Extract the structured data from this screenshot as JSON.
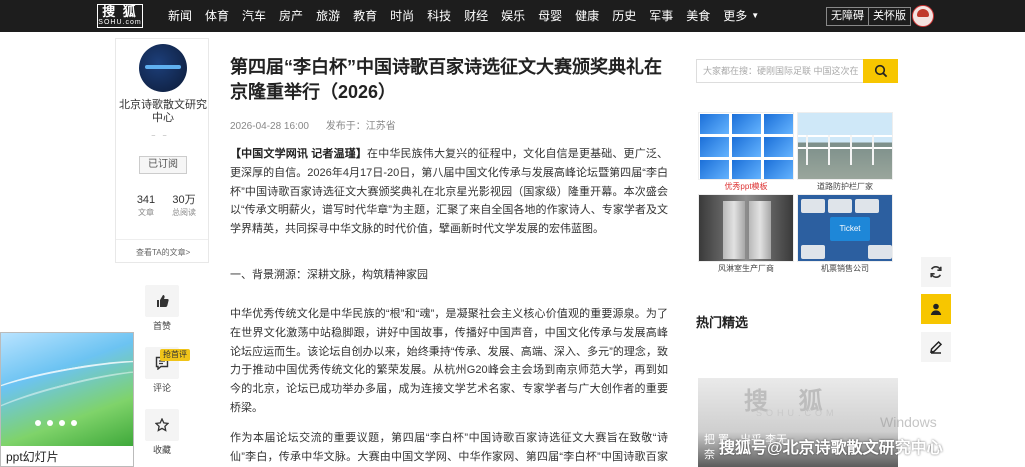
{
  "header": {
    "logo_text": "搜 狐",
    "logo_sub": "SOHU.com",
    "nav": [
      "新闻",
      "体育",
      "汽车",
      "房产",
      "旅游",
      "教育",
      "时尚",
      "科技",
      "财经",
      "娱乐",
      "母婴",
      "健康",
      "历史",
      "军事",
      "美食"
    ],
    "more_label": "更多",
    "accessibility": [
      "无障碍",
      "关怀版"
    ]
  },
  "author": {
    "name": "北京诗歌散文研究中心",
    "follow_label": "已订阅",
    "articles_count": "341",
    "articles_label": "文章",
    "reads_count": "30万",
    "reads_label": "总阅读",
    "see_articles": "查看TA的文章>"
  },
  "actions": {
    "like_label": "首赞",
    "comment_label": "评论",
    "comment_tag": "抢首评",
    "collect_label": "收藏"
  },
  "popup": {
    "label": "ppt幻灯片"
  },
  "article": {
    "title": "第四届“李白杯”中国诗歌百家诗选征文大赛颁奖典礼在京隆重举行（2026）",
    "date": "2026-04-28 16:00",
    "origin": "发布于：江苏省",
    "lead": "【中国文学网讯 记者温瑾】",
    "p1": "在中华民族伟大复兴的征程中，文化自信是更基础、更广泛、更深厚的自信。2026年4月17日-20日，第八届中国文化传承与发展高峰论坛暨第四届“李白杯”中国诗歌百家诗选征文大赛颁奖典礼在北京星光影视园（国家级）隆重开幕。本次盛会以“传承文明薪火，谱写时代华章”为主题，汇聚了来自全国各地的作家诗人、专家学者及文学界精英，共同探寻中华文脉的时代价值，擘画新时代文学发展的宏伟蓝图。",
    "section": "一、背景溯源：深耕文脉，构筑精神家园",
    "p2": "中华优秀传统文化是中华民族的“根”和“魂”，是凝聚社会主义核心价值观的重要源泉。为了在世界文化激荡中站稳脚跟，讲好中国故事，传播好中国声音，中国文化传承与发展高峰论坛应运而生。该论坛自创办以来，始终秉持“传承、发展、高端、深入、多元”的理念，致力于推动中国优秀传统文化的繁荣发展。从杭州G20峰会主会场到南京师范大学，再到如今的北京，论坛已成功举办多届，成为连接文学艺术名家、专家学者与广大创作者的重要桥梁。",
    "p3": "作为本届论坛交流的重要议题，第四届“李白杯”中国诗歌百家诗选征文大赛旨在致敬“诗仙”李白，传承中华文脉。大赛由中国文学网、中华作家网、第四届“李白杯”中国诗歌百家诗选"
  },
  "sidebar": {
    "search_placeholder": "大家都在搜：硬刚国际足联 中国这次在",
    "ads": [
      "优秀ppt模板",
      "道路防护栏厂家",
      "风淋室生产厂商",
      "机票销售公司"
    ],
    "ad_ticket_text": "Ticket",
    "hot_title": "热门精选",
    "hot_wm": "搜 狐",
    "hot_wm2": "SOHU.COM",
    "hot_caption": "把 置，出乎 李无奈"
  },
  "overlays": {
    "windows_watermark": "Windows",
    "sohu_watermark": "搜狐号@北京诗歌散文研究中心"
  },
  "colors": {
    "accent": "#f7c600",
    "nav_bg": "#1d1d1d",
    "ad_caption_red": "#d33333"
  }
}
